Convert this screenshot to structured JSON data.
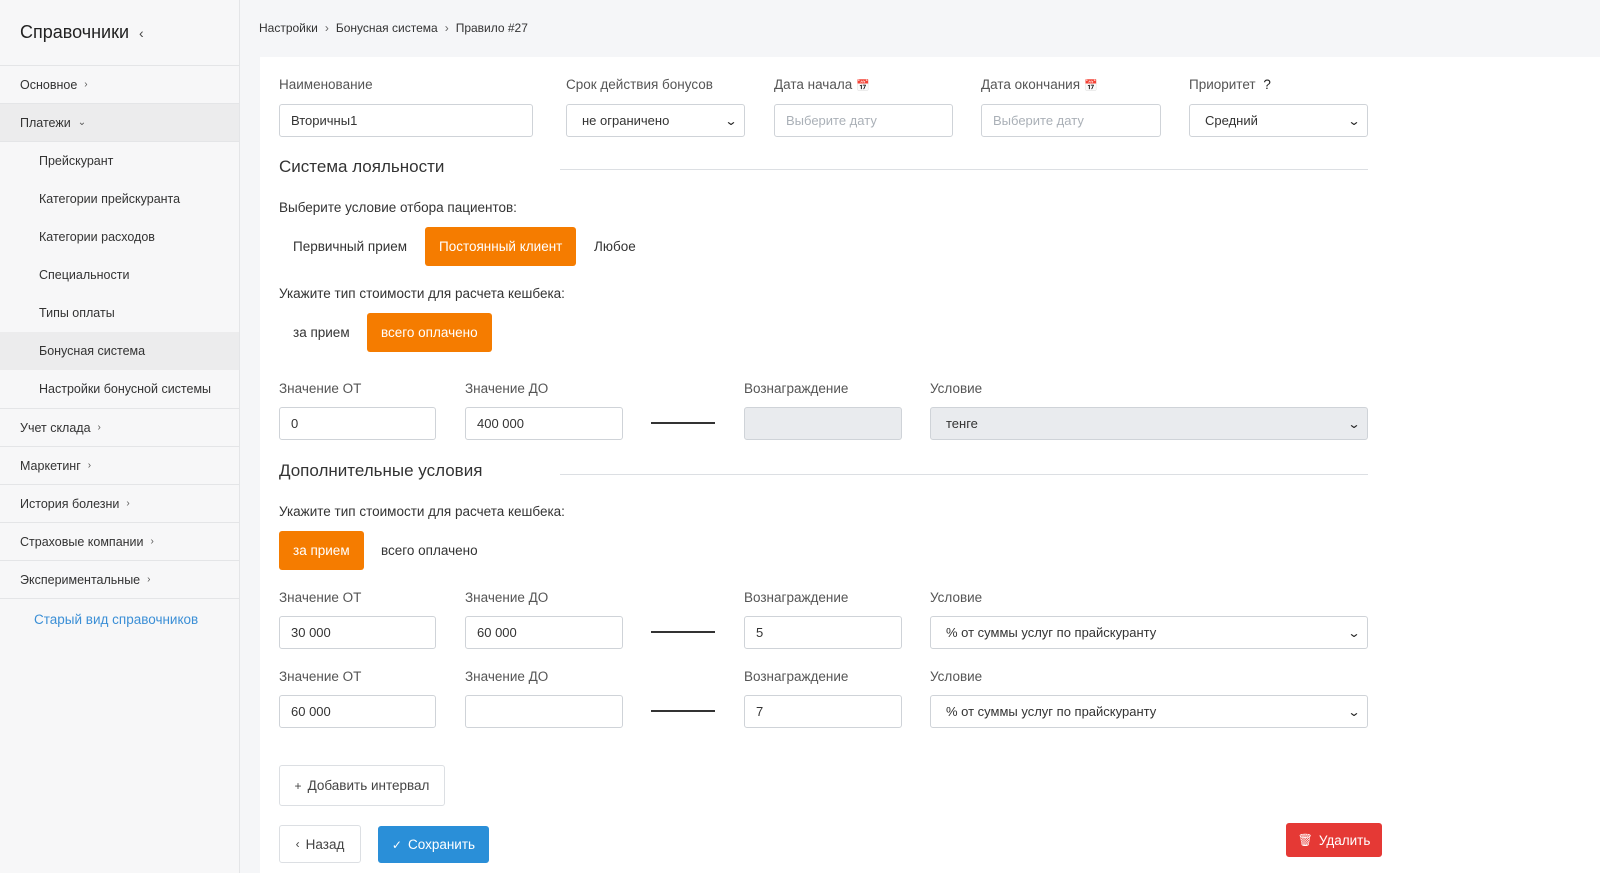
{
  "sidebar": {
    "title": "Справочники",
    "collapse_icon": "chevron-left-icon",
    "items": [
      {
        "label": "Основное"
      },
      {
        "label": "Платежи"
      },
      {
        "label": "Учет склада"
      },
      {
        "label": "Маркетинг"
      },
      {
        "label": "История болезни"
      },
      {
        "label": "Страховые компании"
      },
      {
        "label": "Экспериментальные"
      }
    ],
    "payments_sub": [
      {
        "label": "Прейскурант"
      },
      {
        "label": "Категории прейскуранта"
      },
      {
        "label": "Категории расходов"
      },
      {
        "label": "Специальности"
      },
      {
        "label": "Типы оплаты"
      },
      {
        "label": "Бонусная система"
      },
      {
        "label": "Настройки бонусной системы"
      }
    ],
    "old_view_link": "Старый вид справочников"
  },
  "breadcrumb": [
    "Настройки",
    "Бонусная система",
    "Правило #27"
  ],
  "form": {
    "name": {
      "label": "Наименование",
      "value": "Вторичны1"
    },
    "validity": {
      "label": "Срок действия бонусов",
      "value": "не ограничено"
    },
    "start_date": {
      "label": "Дата начала",
      "placeholder": "Выберите дату"
    },
    "end_date": {
      "label": "Дата окончания",
      "placeholder": "Выберите дату"
    },
    "priority": {
      "label": "Приоритет",
      "help": "?",
      "value": "Средний"
    }
  },
  "loyalty": {
    "title": "Система лояльности",
    "patient_prompt": "Выберите условие отбора пациентов:",
    "patient_options": [
      "Первичный прием",
      "Постоянный клиент",
      "Любое"
    ],
    "patient_selected": "Постоянный клиент",
    "cost_prompt": "Укажите тип стоимости для расчета кешбека:",
    "cost_options": [
      "за прием",
      "всего оплачено"
    ],
    "cost_selected": "всего оплачено",
    "row": {
      "from_label": "Значение ОТ",
      "from_value": "0",
      "to_label": "Значение ДО",
      "to_value": "400 000",
      "reward_label": "Вознаграждение",
      "reward_value": "",
      "condition_label": "Условие",
      "condition_value": "тенге"
    }
  },
  "additional": {
    "title": "Дополнительные условия",
    "cost_prompt": "Укажите тип стоимости для расчета кешбека:",
    "cost_options": [
      "за прием",
      "всего оплачено"
    ],
    "cost_selected": "за прием",
    "rows": [
      {
        "from_label": "Значение ОТ",
        "from_value": "30 000",
        "to_label": "Значение ДО",
        "to_value": "60 000",
        "reward_label": "Вознаграждение",
        "reward_value": "5",
        "condition_label": "Условие",
        "condition_value": "% от суммы услуг по прайскуранту"
      },
      {
        "from_label": "Значение ОТ",
        "from_value": "60 000",
        "to_label": "Значение ДО",
        "to_value": "",
        "reward_label": "Вознаграждение",
        "reward_value": "7",
        "condition_label": "Условие",
        "condition_value": "% от суммы услуг по прайскуранту"
      }
    ],
    "add_interval": "Добавить интервал"
  },
  "actions": {
    "back": "Назад",
    "save": "Сохранить",
    "delete": "Удалить"
  },
  "colors": {
    "accent_orange": "#f57c00",
    "primary_blue": "#2a8fd8",
    "danger_red": "#e53935",
    "link_blue": "#3b8fd6"
  }
}
